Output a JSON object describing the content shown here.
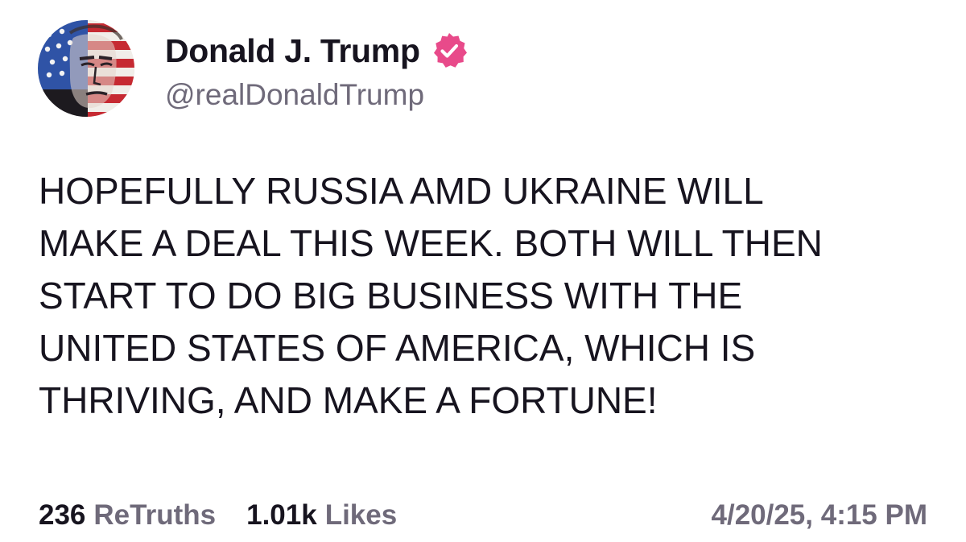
{
  "author": {
    "display_name": "Donald J. Trump",
    "handle": "@realDonaldTrump",
    "verified": true,
    "verified_color": "#e84a8a",
    "avatar_icon": "flag-portrait-avatar"
  },
  "post": {
    "lines": [
      "HOPEFULLY RUSSIA AMD UKRAINE WILL",
      "MAKE A DEAL THIS WEEK. BOTH WILL THEN",
      "START TO DO BIG BUSINESS WITH THE",
      "UNITED STATES OF AMERICA, WHICH IS",
      "THRIVING, AND MAKE A FORTUNE!"
    ]
  },
  "stats": {
    "retruths_count": "236",
    "retruths_label": "ReTruths",
    "likes_count": "1.01k",
    "likes_label": "Likes",
    "timestamp": "4/20/25, 4:15 PM"
  },
  "colors": {
    "text_primary": "#17141f",
    "text_secondary": "#6f6a7a",
    "background": "#ffffff"
  }
}
